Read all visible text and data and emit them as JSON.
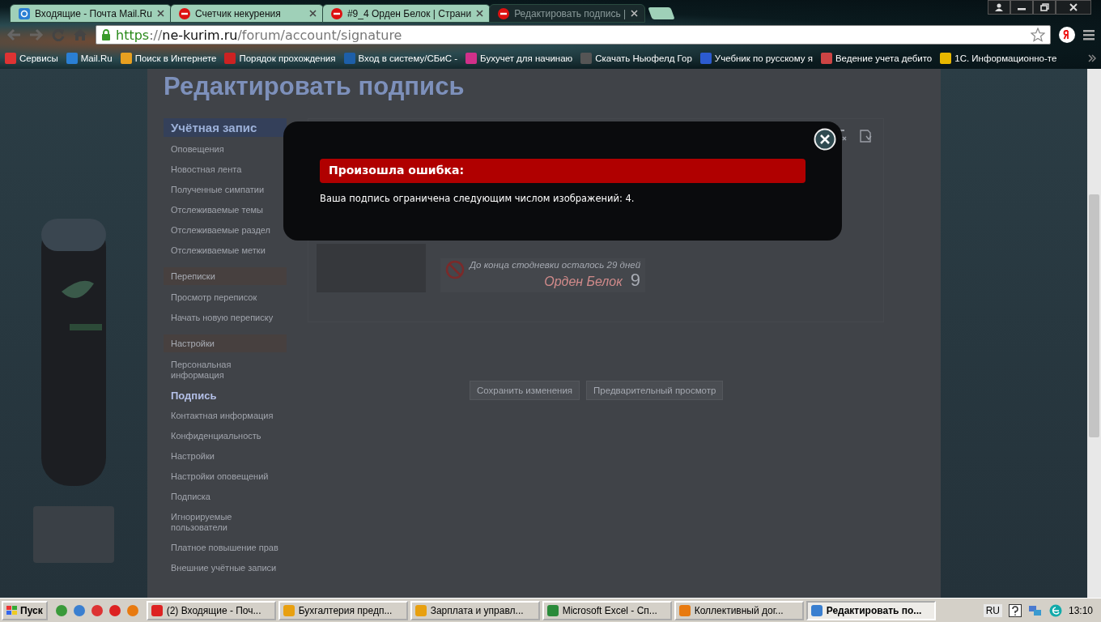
{
  "browser": {
    "tabs": [
      {
        "title": "Входящие - Почта Mail.Ru",
        "selected": false
      },
      {
        "title": "Счетчик некурения",
        "selected": false
      },
      {
        "title": "#9_4 Орден Белок | Страни",
        "selected": false
      },
      {
        "title": "Редактировать подпись |",
        "selected": true
      }
    ],
    "address": {
      "scheme": "https",
      "separator": "://",
      "host": "ne-kurim.ru",
      "path": "/forum/account/signature"
    },
    "bookmarks": [
      "Сервисы",
      "Mail.Ru",
      "Поиск в Интернете",
      "Порядок прохождения",
      "Вход в систему/СБиС -",
      "Бухучет для начинаю",
      "Скачать Ньюфелд Гор",
      "Учебник по русскому я",
      "Ведение учета дебито",
      "1С. Информационно-те"
    ]
  },
  "page": {
    "heading": "Редактировать подпись",
    "sidebar": [
      {
        "title": "Учётная запис",
        "kind": "primary",
        "items": [
          {
            "label": "Оповещения",
            "selected": false
          },
          {
            "label": "Новостная лента",
            "selected": false
          },
          {
            "label": "Полученные симпатии",
            "selected": false
          },
          {
            "label": "Отслеживаемые темы",
            "selected": false
          },
          {
            "label": "Отслеживаемые раздел",
            "selected": false
          },
          {
            "label": "Отслеживаемые метки",
            "selected": false
          }
        ]
      },
      {
        "title": "Переписки",
        "kind": "secondary",
        "items": [
          {
            "label": "Просмотр переписок",
            "selected": false
          },
          {
            "label": "Начать новую переписку",
            "selected": false
          }
        ]
      },
      {
        "title": "Настройки",
        "kind": "secondary",
        "items": [
          {
            "label": "Персональная информация",
            "selected": false
          },
          {
            "label": "Подпись",
            "selected": true
          },
          {
            "label": "Контактная информация",
            "selected": false
          },
          {
            "label": "Конфиденциальность",
            "selected": false
          },
          {
            "label": "Настройки",
            "selected": false
          },
          {
            "label": "Настройки оповещений",
            "selected": false
          },
          {
            "label": "Подписка",
            "selected": false
          },
          {
            "label": "Игнорируемые пользователи",
            "selected": false
          },
          {
            "label": "Платное повышение прав",
            "selected": false
          },
          {
            "label": "Внешние учётные записи",
            "selected": false
          }
        ]
      }
    ],
    "signature": {
      "counter_text": "До конца стодневки осталось 29 дней",
      "order_name": "Орден Белок",
      "order_number": "9"
    },
    "buttons": [
      "Сохранить изменения",
      "Предварительный просмотр"
    ]
  },
  "dialog": {
    "title": "Произошла ошибка:",
    "message": "Ваша подпись ограничена следующим числом изображений: 4."
  },
  "taskbar": {
    "start": "Пуск",
    "tasks": [
      {
        "label": "(2) Входящие - Поч...",
        "selected": false
      },
      {
        "label": "Бухгалтерия предп...",
        "selected": false
      },
      {
        "label": "Зарплата и управл...",
        "selected": false
      },
      {
        "label": "Microsoft Excel - Сп...",
        "selected": false
      },
      {
        "label": "Коллективный дог...",
        "selected": false
      },
      {
        "label": "Редактировать по...",
        "selected": true
      }
    ],
    "language": "RU",
    "clock": "13:10"
  }
}
